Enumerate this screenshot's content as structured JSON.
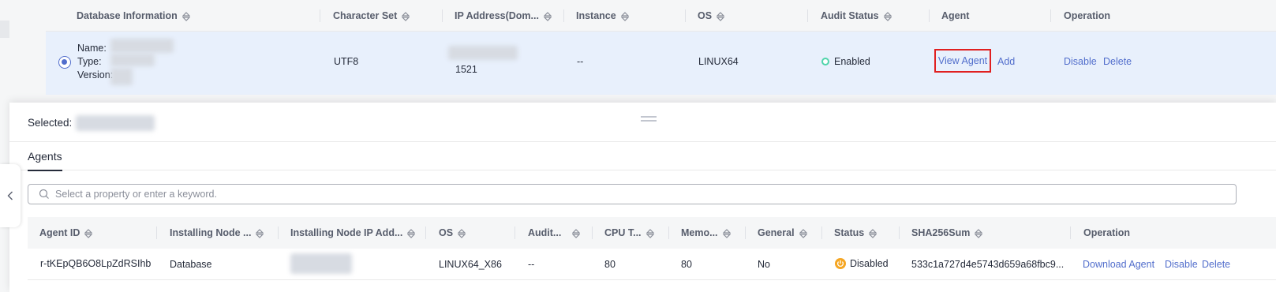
{
  "top_table": {
    "headers": [
      "Database Information",
      "Character Set",
      "IP Address(Dom...",
      "Instance",
      "OS",
      "Audit Status",
      "Agent",
      "Operation"
    ],
    "row": {
      "info_labels": [
        "Name:",
        "Type:",
        "Version:"
      ],
      "charset": "UTF8",
      "port": "1521",
      "instance": "--",
      "os": "LINUX64",
      "audit_status": "Enabled",
      "agent_view": "View Agent",
      "agent_add": "Add",
      "op_disable": "Disable",
      "op_delete": "Delete"
    }
  },
  "drawer": {
    "selected_label": "Selected:",
    "tab": "Agents",
    "search_placeholder": "Select a property or enter a keyword.",
    "table": {
      "headers": [
        "Agent ID",
        "Installing Node ...",
        "Installing Node IP Add...",
        "OS",
        "Audit...",
        "CPU T...",
        "Memo...",
        "General",
        "Status",
        "SHA256Sum",
        "Operation"
      ],
      "row": {
        "agent_id": "r-tKEpQB6O8LpZdRSIhb",
        "node_type": "Database",
        "os": "LINUX64_X86",
        "audit": "--",
        "cpu": "80",
        "memory": "80",
        "general": "No",
        "status": "Disabled",
        "sha": "533c1a727d4e5743d659a68fbc9...",
        "op_download": "Download Agent",
        "op_disable": "Disable",
        "op_delete": "Delete"
      }
    }
  },
  "colors": {
    "accent": "#526ecc",
    "enabled": "#50d4ab",
    "disabled": "#f5a623",
    "highlight_box": "#e02020",
    "selected_row": "#e8f0fc"
  }
}
